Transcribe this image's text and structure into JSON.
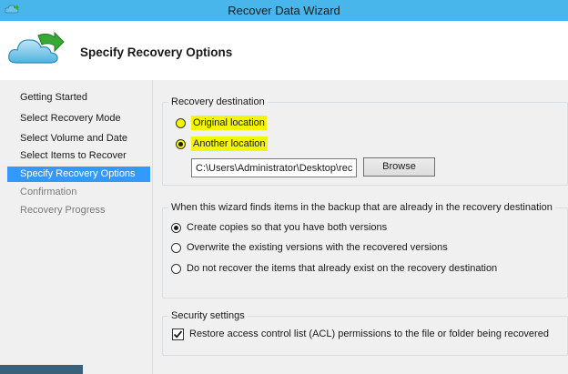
{
  "window": {
    "title": "Recover Data Wizard"
  },
  "header": {
    "title": "Specify Recovery Options"
  },
  "nav": {
    "items": [
      {
        "label": "Getting Started",
        "state": "done"
      },
      {
        "label": "Select Recovery Mode",
        "state": "done"
      },
      {
        "label": "Select Volume and Date",
        "state": "done"
      },
      {
        "label": "Select Items to Recover",
        "state": "done"
      },
      {
        "label": "Specify Recovery Options",
        "state": "active"
      },
      {
        "label": "Confirmation",
        "state": "pending"
      },
      {
        "label": "Recovery Progress",
        "state": "pending"
      }
    ]
  },
  "destination": {
    "legend": "Recovery destination",
    "original_label": "Original location",
    "another_label": "Another location",
    "selected": "another",
    "path_value": "C:\\Users\\Administrator\\Desktop\\recc",
    "browse_label": "Browse"
  },
  "conflict": {
    "legend": "When this wizard finds items in the backup that are already in the recovery destination",
    "options": [
      {
        "label": "Create copies so that you have both versions",
        "selected": true
      },
      {
        "label": "Overwrite the existing versions with the recovered versions",
        "selected": false
      },
      {
        "label": "Do not recover the items that already exist on the recovery destination",
        "selected": false
      }
    ]
  },
  "security": {
    "legend": "Security settings",
    "acl_label": "Restore access control list (ACL) permissions to the file or folder being recovered",
    "acl_checked": true
  },
  "colors": {
    "titlebar": "#48b6ea",
    "nav_active": "#3399ff",
    "highlight": "#f5f500",
    "panel_bg": "#f0f0f0"
  }
}
